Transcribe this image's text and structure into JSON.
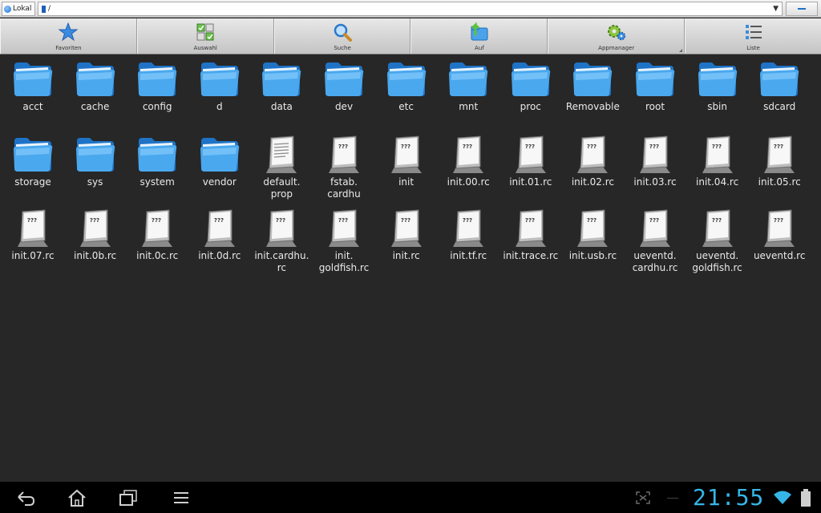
{
  "addressbar": {
    "location_label": "Lokal",
    "path": "/"
  },
  "toolbar": [
    {
      "label": "Favoriten",
      "icon": "star-icon"
    },
    {
      "label": "Auswahl",
      "icon": "select-grid-icon"
    },
    {
      "label": "Suche",
      "icon": "search-icon"
    },
    {
      "label": "Auf",
      "icon": "folder-up-icon"
    },
    {
      "label": "Appmanager",
      "icon": "gears-icon"
    },
    {
      "label": "Liste",
      "icon": "list-icon"
    }
  ],
  "files": [
    {
      "name": "acct",
      "type": "folder"
    },
    {
      "name": "cache",
      "type": "folder"
    },
    {
      "name": "config",
      "type": "folder"
    },
    {
      "name": "d",
      "type": "folder"
    },
    {
      "name": "data",
      "type": "folder"
    },
    {
      "name": "dev",
      "type": "folder"
    },
    {
      "name": "etc",
      "type": "folder"
    },
    {
      "name": "mnt",
      "type": "folder"
    },
    {
      "name": "proc",
      "type": "folder"
    },
    {
      "name": "Removable",
      "type": "folder"
    },
    {
      "name": "root",
      "type": "folder"
    },
    {
      "name": "sbin",
      "type": "folder"
    },
    {
      "name": "sdcard",
      "type": "folder"
    },
    {
      "name": "storage",
      "type": "folder"
    },
    {
      "name": "sys",
      "type": "folder"
    },
    {
      "name": "system",
      "type": "folder"
    },
    {
      "name": "vendor",
      "type": "folder"
    },
    {
      "name": "default.\nprop",
      "type": "text"
    },
    {
      "name": "fstab.\ncardhu",
      "type": "unknown"
    },
    {
      "name": "init",
      "type": "unknown"
    },
    {
      "name": "init.00.rc",
      "type": "unknown"
    },
    {
      "name": "init.01.rc",
      "type": "unknown"
    },
    {
      "name": "init.02.rc",
      "type": "unknown"
    },
    {
      "name": "init.03.rc",
      "type": "unknown"
    },
    {
      "name": "init.04.rc",
      "type": "unknown"
    },
    {
      "name": "init.05.rc",
      "type": "unknown"
    },
    {
      "name": "init.07.rc",
      "type": "unknown"
    },
    {
      "name": "init.0b.rc",
      "type": "unknown"
    },
    {
      "name": "init.0c.rc",
      "type": "unknown"
    },
    {
      "name": "init.0d.rc",
      "type": "unknown"
    },
    {
      "name": "init.cardhu.\nrc",
      "type": "unknown"
    },
    {
      "name": "init.\ngoldfish.rc",
      "type": "unknown"
    },
    {
      "name": "init.rc",
      "type": "unknown"
    },
    {
      "name": "init.tf.rc",
      "type": "unknown"
    },
    {
      "name": "init.trace.rc",
      "type": "unknown"
    },
    {
      "name": "init.usb.rc",
      "type": "unknown"
    },
    {
      "name": "ueventd.\ncardhu.rc",
      "type": "unknown"
    },
    {
      "name": "ueventd.\ngoldfish.rc",
      "type": "unknown"
    },
    {
      "name": "ueventd.rc",
      "type": "unknown"
    }
  ],
  "navbar": {
    "clock": "21:55",
    "buttons": [
      "back-icon",
      "home-icon",
      "recent-apps-icon",
      "menu-icon"
    ],
    "status_icons": [
      "screenshot-icon",
      "wifi-icon",
      "battery-icon"
    ]
  },
  "colors": {
    "background": "#272727",
    "folder_blue": "#3f9fe6",
    "clock": "#35b6e6"
  }
}
